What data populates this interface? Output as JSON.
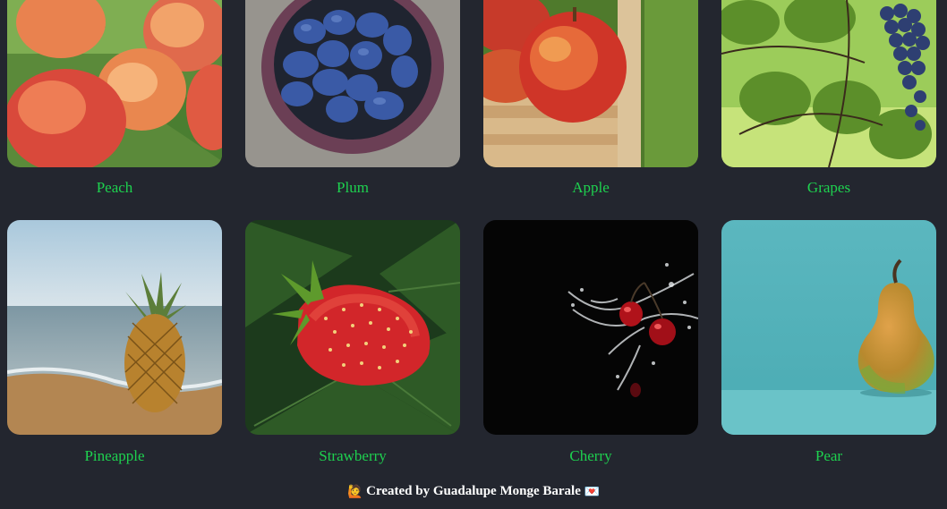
{
  "fruits": [
    {
      "name": "Peach"
    },
    {
      "name": "Plum"
    },
    {
      "name": "Apple"
    },
    {
      "name": "Grapes"
    },
    {
      "name": "Pineapple"
    },
    {
      "name": "Strawberry"
    },
    {
      "name": "Cherry"
    },
    {
      "name": "Pear"
    }
  ],
  "footer": {
    "text": "Created by Guadalupe Monge Barale",
    "emoji_left": "🙋",
    "emoji_right": "💌"
  },
  "colors": {
    "background": "#23262f",
    "label": "#1ed14f",
    "footer_text": "#ffffff"
  }
}
